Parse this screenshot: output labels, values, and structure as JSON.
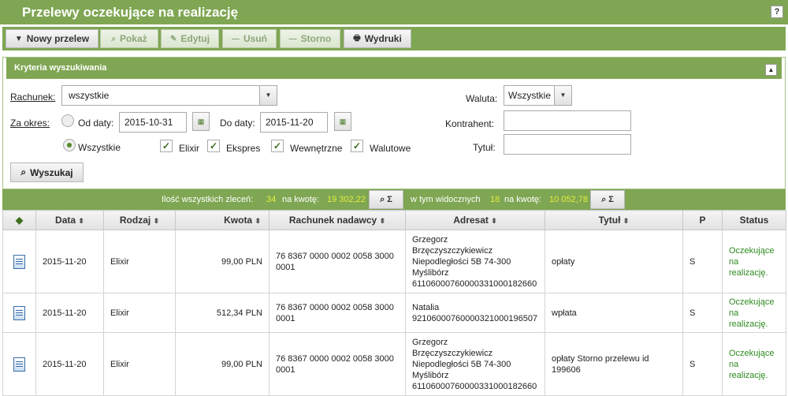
{
  "header": {
    "title": "Przelewy oczekujące na realizację",
    "help_label": "?"
  },
  "toolbar": {
    "buttons": [
      {
        "label": "Nowy przelew",
        "icon": "▼"
      },
      {
        "label": "Pokaż",
        "icon": "⌕"
      },
      {
        "label": "Edytuj",
        "icon": "✎"
      },
      {
        "label": "Usuń",
        "icon": "—"
      },
      {
        "label": "Storno",
        "icon": "—"
      },
      {
        "label": "Wydruki",
        "icon": "🖶"
      }
    ]
  },
  "criteria": {
    "title": "Kryteria wyszukiwania",
    "collapse_icon": "▲",
    "account_label": "Rachunek:",
    "account_value": "wszystkie",
    "period_label": "Za okres:",
    "from_label": "Od daty:",
    "from_value": "2015-10-31",
    "to_label": "Do daty:",
    "to_value": "2015-11-20",
    "all_label": "Wszystkie",
    "types": [
      {
        "label": "Elixir",
        "checked": true
      },
      {
        "label": "Ekspres",
        "checked": true
      },
      {
        "label": "Wewnętrzne",
        "checked": true
      },
      {
        "label": "Walutowe",
        "checked": true
      }
    ],
    "currency_label": "Waluta:",
    "currency_value": "Wszystkie",
    "counterparty_label": "Kontrahent:",
    "counterparty_value": "",
    "title_label": "Tytuł:",
    "title_value": "",
    "search_label": "Wyszukaj",
    "search_icon": "⌕"
  },
  "summary": {
    "total_label": "Ilość wszystkich zleceń:",
    "total_count": "34",
    "amount_label": "na kwotę:",
    "total_amount": "19 302,22",
    "visible_label": "w tym widocznych",
    "visible_count": "18",
    "visible_amount": "10 052,78",
    "sum_label": "⌕ Σ"
  },
  "table": {
    "headers": [
      "",
      "Data",
      "Rodzaj",
      "Kwota",
      "Rachunek nadawcy",
      "Adresat",
      "Tytuł",
      "P",
      "Status"
    ],
    "sort_icon": "⬍",
    "rows": [
      {
        "date": "2015-11-20",
        "type": "Elixir",
        "amount": "99,00 PLN",
        "account": "76 8367 0000 0002 0058 3000 0001",
        "recipient": [
          "Grzegorz",
          "Brzęczyszczykiewicz",
          "Niepodległości 5B 74-300",
          "Myślibórz",
          "61106000760000331000182660"
        ],
        "title": "opłaty",
        "p": "S",
        "status": [
          "Oczekujące",
          "na",
          "realizację."
        ]
      },
      {
        "date": "2015-11-20",
        "type": "Elixir",
        "amount": "512,34 PLN",
        "account": "76 8367 0000 0002 0058 3000 0001",
        "recipient": [
          "Natalia",
          "92106000760000321000196507"
        ],
        "title": "wpłata",
        "p": "S",
        "status": [
          "Oczekujące",
          "na",
          "realizację."
        ]
      },
      {
        "date": "2015-11-20",
        "type": "Elixir",
        "amount": "99,00 PLN",
        "account": "76 8367 0000 0002 0058 3000 0001",
        "recipient": [
          "Grzegorz",
          "Brzęczyszczykiewicz",
          "Niepodległości 5B 74-300",
          "Myślibórz",
          "61106000760000331000182660"
        ],
        "title": "opłaty Storno przelewu id 199606",
        "p": "S",
        "status": [
          "Oczekujące",
          "na",
          "realizację."
        ]
      }
    ]
  }
}
